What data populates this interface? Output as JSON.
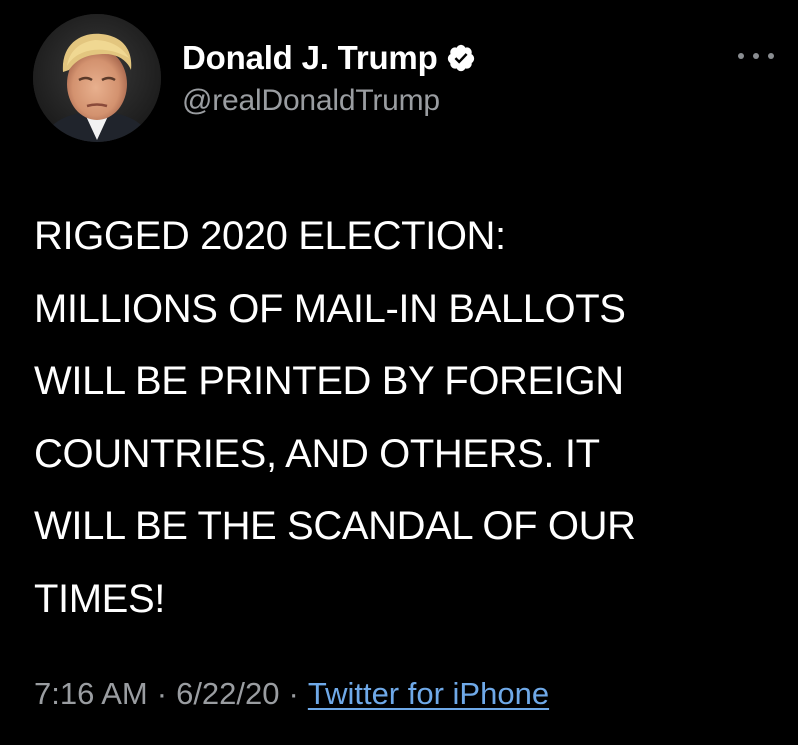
{
  "tweet": {
    "author": {
      "display_name": "Donald J. Trump",
      "handle": "@realDonaldTrump",
      "verified": true,
      "avatar_icon": "profile-photo"
    },
    "menu_icon": "more-horizontal-icon",
    "text_lines": [
      "RIGGED 2020 ELECTION:",
      "MILLIONS OF MAIL-IN BALLOTS",
      "WILL BE PRINTED BY FOREIGN",
      "COUNTRIES, AND OTHERS. IT",
      "WILL BE THE SCANDAL OF OUR",
      "TIMES!"
    ],
    "meta": {
      "time": "7:16 AM",
      "separator": "·",
      "date": "6/22/20",
      "source": "Twitter for iPhone"
    }
  },
  "colors": {
    "background": "#000000",
    "text": "#ffffff",
    "secondary_text": "#9a9da1",
    "link": "#6fa9e8"
  }
}
